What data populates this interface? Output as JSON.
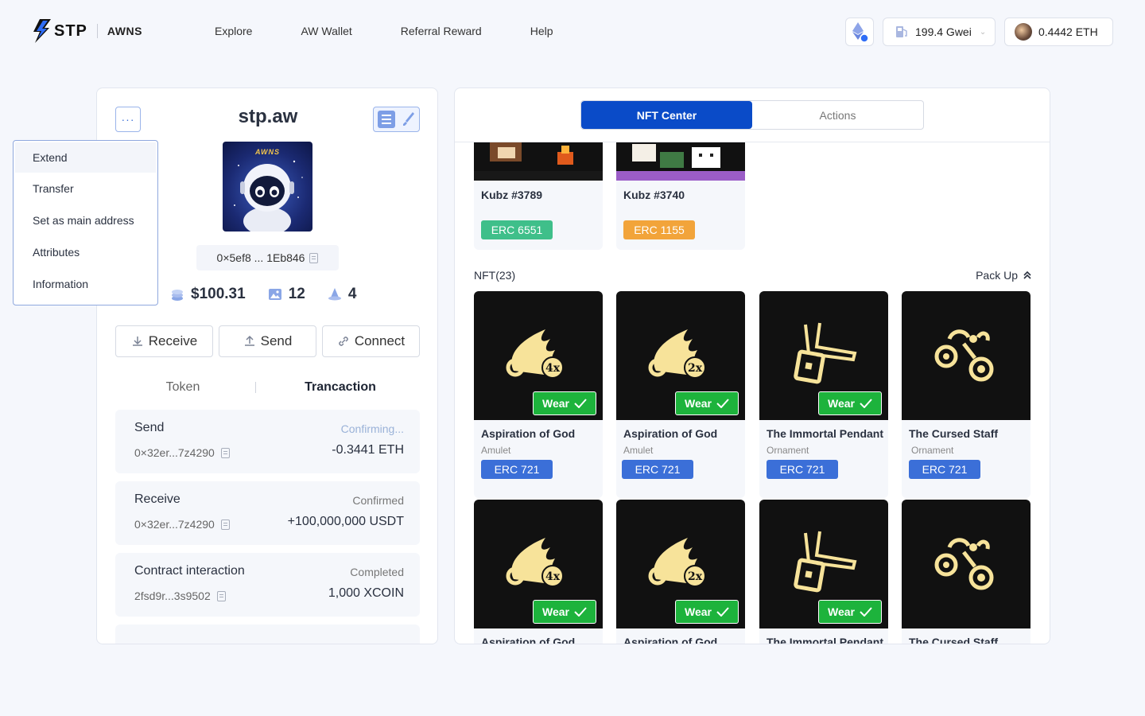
{
  "header": {
    "logo_text": "STP",
    "logo_sub": "AWNS",
    "nav": [
      "Explore",
      "AW Wallet",
      "Referral Reward",
      "Help"
    ],
    "gas": "199.4 Gwei",
    "balance": "0.4442 ETH"
  },
  "profile": {
    "name": "stp.aw",
    "avatar_brand": "AWNS",
    "address": "0×5ef8 ... 1Eb846",
    "stats": {
      "value": "$100.31",
      "nfts": "12",
      "count": "4"
    },
    "actions": {
      "receive": "Receive",
      "send": "Send",
      "connect": "Connect"
    },
    "tabs": {
      "token": "Token",
      "transaction": "Trancaction"
    },
    "transactions": [
      {
        "type": "Send",
        "hash": "0×32er...7z4290",
        "status": "Confirming...",
        "amount": "-0.3441 ETH"
      },
      {
        "type": "Receive",
        "hash": "0×32er...7z4290",
        "status": "Confirmed",
        "amount": "+100,000,000 USDT"
      },
      {
        "type": "Contract interaction",
        "hash": "2fsd9r...3s9502",
        "status": "Completed",
        "amount": "1,000 XCOIN"
      }
    ]
  },
  "menu": [
    "Extend",
    "Transfer",
    "Set as main address",
    "Attributes",
    "Information"
  ],
  "nft_center": {
    "tabs": {
      "nft_center": "NFT Center",
      "actions": "Actions"
    },
    "top_cards": [
      {
        "title": "Kubz #3789",
        "tag": "ERC 6551"
      },
      {
        "title": "Kubz #3740",
        "tag": "ERC 1155"
      }
    ],
    "section_title": "NFT(23)",
    "pack_up": "Pack Up",
    "wear_label": "Wear",
    "cards": [
      {
        "title": "Aspiration of God",
        "sub": "Amulet",
        "tag": "ERC 721",
        "badge": "4x",
        "icon": "wing-icon",
        "wear": true
      },
      {
        "title": "Aspiration of God",
        "sub": "Amulet",
        "tag": "ERC 721",
        "badge": "2x",
        "icon": "wing-icon",
        "wear": true
      },
      {
        "title": "The Immortal Pendant",
        "sub": "Ornament",
        "tag": "ERC 721",
        "icon": "pendant-icon",
        "wear": true
      },
      {
        "title": "The Cursed Staff",
        "sub": "Ornament",
        "tag": "ERC 721",
        "icon": "staff-icon",
        "wear": false
      },
      {
        "title": "Aspiration of God",
        "badge": "4x",
        "icon": "wing-icon",
        "wear": true
      },
      {
        "title": "Aspiration of God",
        "badge": "2x",
        "icon": "wing-icon",
        "wear": true
      },
      {
        "title": "The Immortal Pendant",
        "icon": "pendant-icon",
        "wear": true
      },
      {
        "title": "The Cursed Staff",
        "icon": "staff-icon",
        "wear": false
      }
    ]
  },
  "colors": {
    "accent": "#0a4bc8",
    "wear": "#1db33c",
    "erc721": "#3b6fd8",
    "erc6551": "#3fbf8a",
    "erc1155": "#f2a43a",
    "gold": "#f7e39a"
  }
}
